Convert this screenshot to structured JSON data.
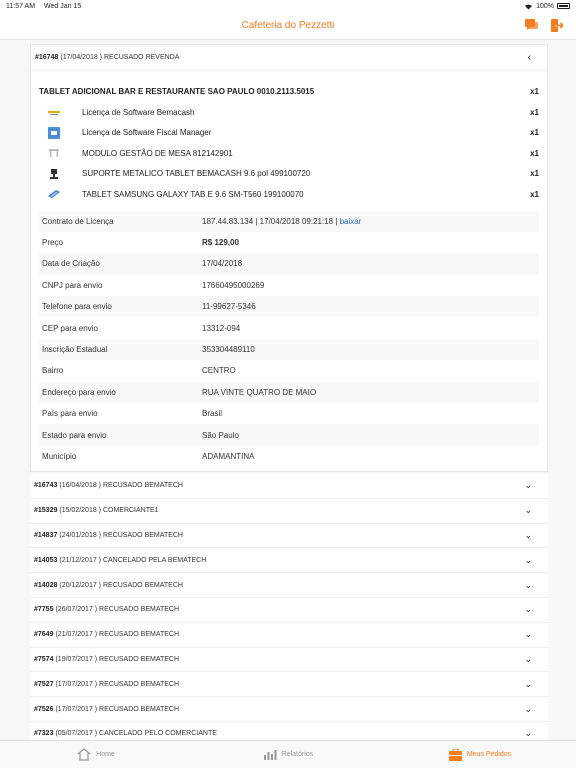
{
  "status": {
    "time": "11:57 AM",
    "date": "Wed Jan 15",
    "battery": "100%"
  },
  "nav": {
    "title": "Cafeteria do Pezzetti"
  },
  "expanded": {
    "id": "#16748",
    "meta": "(17/04/2018 ) RECUSADO REVENDA",
    "product": "TABLET ADICIONAL BAR E RESTAURANTE SAO PAULO 0010.2113.5015",
    "product_qty": "x1",
    "items": [
      {
        "name": "Licença de Software Bemacash",
        "qty": "x1"
      },
      {
        "name": "Licença de Software Fiscal Manager",
        "qty": "x1"
      },
      {
        "name": "MODULO GESTÃO DE MESA 812142901",
        "qty": "x1"
      },
      {
        "name": "SUPORTE METALICO TABLET BEMACASH 9.6 pol 499100720",
        "qty": "x1"
      },
      {
        "name": "TABLET SAMSUNG GALAXY TAB E 9.6 SM-T560 199100070",
        "qty": "x1"
      }
    ],
    "contract": {
      "label": "Contrato de Licença",
      "value": "187.44.83.134 | 17/04/2018 09:21:18 | ",
      "link": "baixar"
    },
    "details": [
      {
        "label": "Preço",
        "value": "R$ 129,00"
      },
      {
        "label": "Data de Criação",
        "value": "17/04/2018"
      },
      {
        "label": "CNPJ para envio",
        "value": "17660495000269"
      },
      {
        "label": "Telefone para envio",
        "value": "11-99627-5346"
      },
      {
        "label": "CEP para envio",
        "value": "13312-094"
      },
      {
        "label": "Inscrição Estadual",
        "value": "353304489110"
      },
      {
        "label": "Bairro",
        "value": "CENTRO"
      },
      {
        "label": "Endereço para envio",
        "value": "RUA VINTE QUATRO DE MAIO"
      },
      {
        "label": "País para envio",
        "value": "Brasil"
      },
      {
        "label": "Estado para envio",
        "value": "São Paulo"
      },
      {
        "label": "Município",
        "value": "ADAMANTINA"
      }
    ]
  },
  "orders": [
    {
      "id": "#16743",
      "meta": "(16/04/2018 ) RECUSADO BEMATECH"
    },
    {
      "id": "#15329",
      "meta": "(15/02/2018 ) COMERCIANTE1"
    },
    {
      "id": "#14837",
      "meta": "(24/01/2018 ) RECUSADO BEMATECH"
    },
    {
      "id": "#14053",
      "meta": "(21/12/2017 ) CANCELADO PELA BEMATECH"
    },
    {
      "id": "#14028",
      "meta": "(20/12/2017 ) RECUSADO BEMATECH"
    },
    {
      "id": "#7755",
      "meta": "(26/07/2017 ) RECUSADO BEMATECH"
    },
    {
      "id": "#7649",
      "meta": "(21/07/2017 ) RECUSADO BEMATECH"
    },
    {
      "id": "#7574",
      "meta": "(19/07/2017 ) RECUSADO BEMATECH"
    },
    {
      "id": "#7527",
      "meta": "(17/07/2017 ) RECUSADO BEMATECH"
    },
    {
      "id": "#7526",
      "meta": "(17/07/2017 ) RECUSADO BEMATECH"
    },
    {
      "id": "#7323",
      "meta": "(05/07/2017 ) CANCELADO PELO COMERCIANTE"
    }
  ],
  "tabs": [
    {
      "label": "Home",
      "icon": "home-icon"
    },
    {
      "label": "Relatórios",
      "icon": "reports-icon"
    },
    {
      "label": "Meus Pedidos",
      "icon": "orders-icon"
    }
  ],
  "colors": {
    "accent": "#f57c1f",
    "link": "#2a6aa8"
  }
}
